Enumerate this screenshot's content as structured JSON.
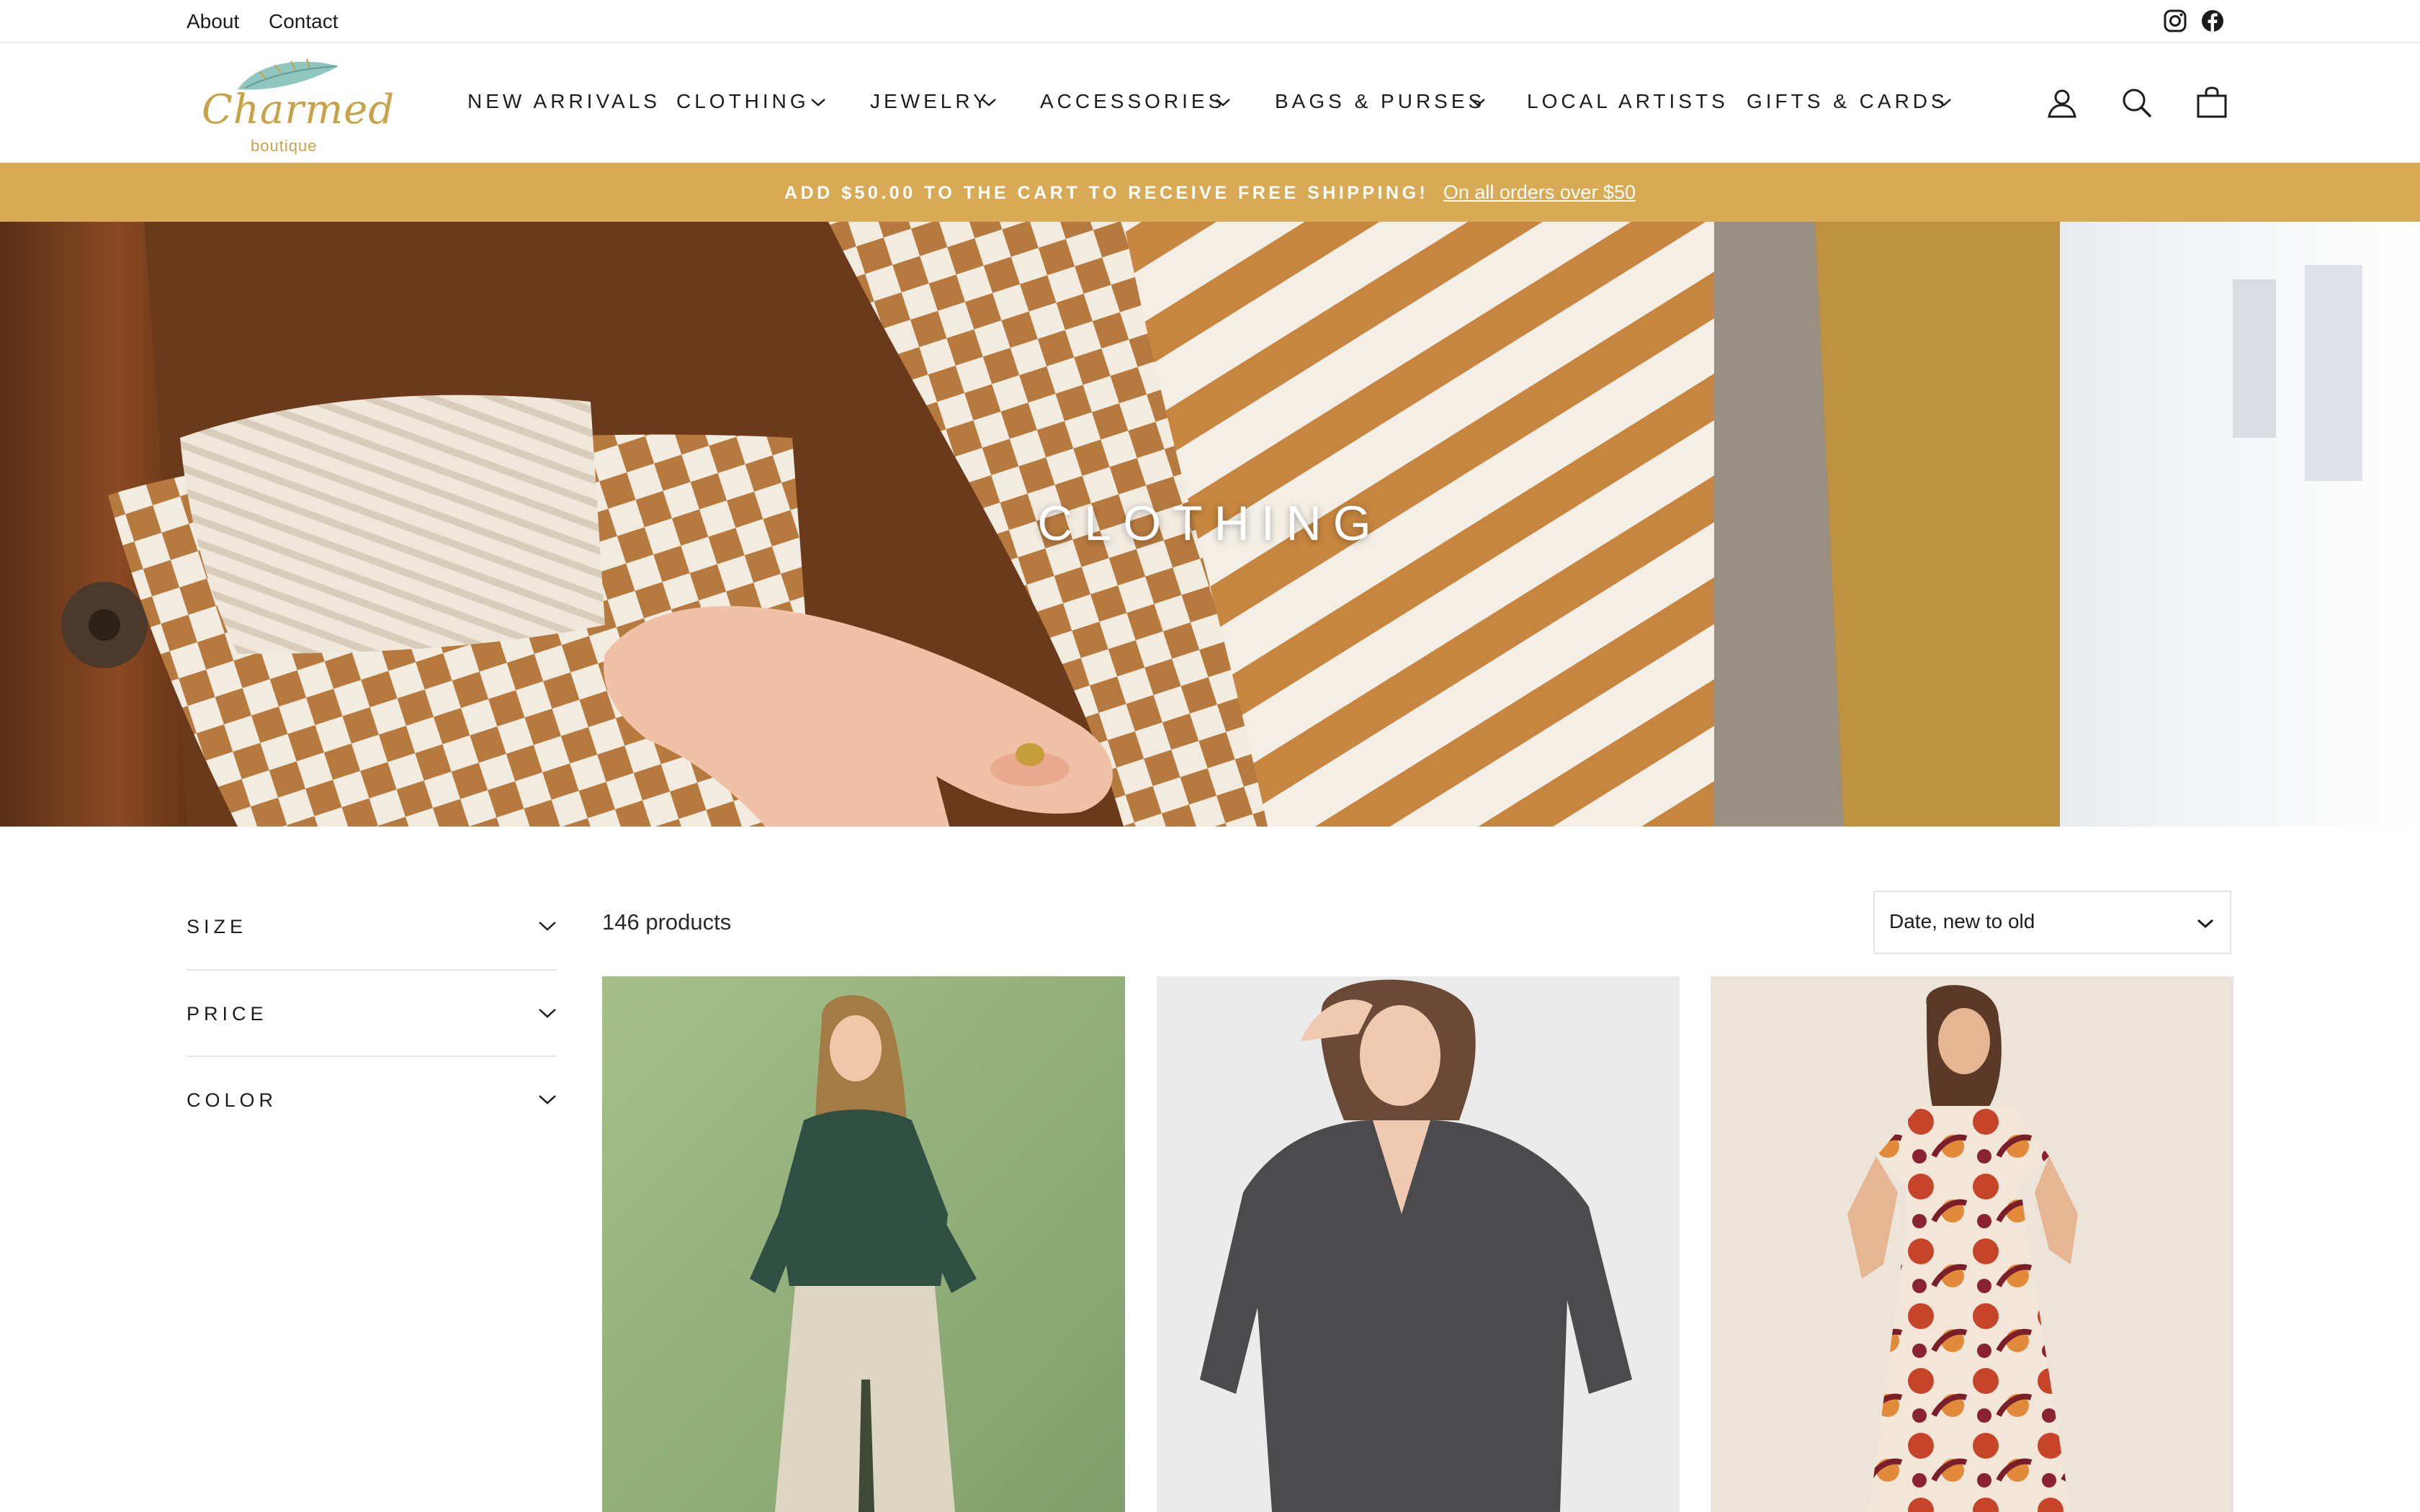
{
  "utility": {
    "links": [
      "About",
      "Contact"
    ],
    "social": [
      "instagram-icon",
      "facebook-icon"
    ]
  },
  "brand": {
    "logo_text": "Charmed",
    "logo_sub": "boutique",
    "color": "#c7a246"
  },
  "nav": {
    "items": [
      {
        "label": "NEW ARRIVALS",
        "dropdown": false
      },
      {
        "label": "CLOTHING",
        "dropdown": true
      },
      {
        "label": "JEWELRY",
        "dropdown": true
      },
      {
        "label": "ACCESSORIES",
        "dropdown": true
      },
      {
        "label": "BAGS & PURSES",
        "dropdown": true
      },
      {
        "label": "LOCAL ARTISTS",
        "dropdown": false
      },
      {
        "label": "GIFTS & CARDS",
        "dropdown": true
      }
    ],
    "icons": [
      "account-icon",
      "search-icon",
      "cart-icon"
    ]
  },
  "announcement": {
    "text": "ADD $50.00 TO THE CART TO RECEIVE FREE SHIPPING!",
    "link": "On all orders over $50",
    "background": "#d9aa55"
  },
  "hero": {
    "title": "CLOTHING"
  },
  "filters": [
    {
      "label": "SIZE"
    },
    {
      "label": "PRICE"
    },
    {
      "label": "COLOR"
    }
  ],
  "products": {
    "count_text": "146 products",
    "sort_value": "Date, new to old",
    "items": [
      {
        "image": "green-sweater-model"
      },
      {
        "image": "grey-sweater-model"
      },
      {
        "image": "floral-dress-model"
      }
    ]
  }
}
